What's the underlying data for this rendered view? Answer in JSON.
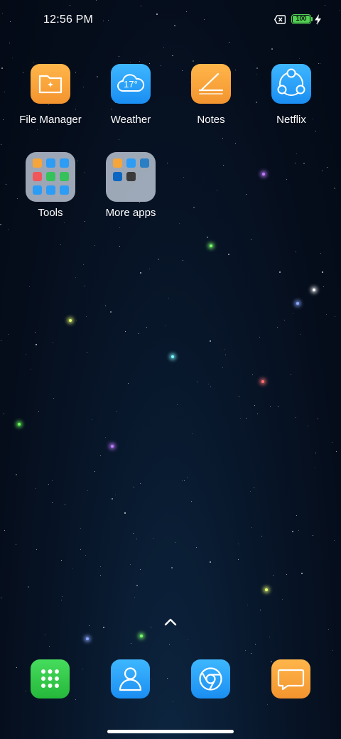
{
  "status_bar": {
    "time": "12:56 PM",
    "battery_level": "100"
  },
  "home": {
    "apps": [
      {
        "label": "File Manager",
        "icon": "folder-icon"
      },
      {
        "label": "Weather",
        "icon": "cloud-icon",
        "temperature": "17°"
      },
      {
        "label": "Notes",
        "icon": "notes-pen-icon"
      },
      {
        "label": "Netflix",
        "icon": "share-nodes-icon"
      }
    ],
    "folders": [
      {
        "label": "Tools"
      },
      {
        "label": "More apps"
      }
    ]
  },
  "dock": [
    {
      "name": "dialer",
      "icon": "keypad-icon"
    },
    {
      "name": "contacts",
      "icon": "person-icon"
    },
    {
      "name": "browser",
      "icon": "chrome-icon"
    },
    {
      "name": "messaging",
      "icon": "message-icon"
    }
  ],
  "colors": {
    "accent_orange": "#f3942f",
    "accent_blue": "#1a8ef2",
    "accent_green": "#25b83c",
    "battery_green": "#53d153"
  }
}
